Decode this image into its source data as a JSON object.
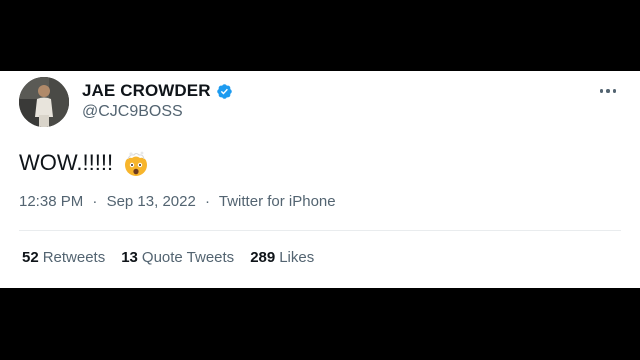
{
  "tweet": {
    "author": {
      "display_name": "JAE CROWDER",
      "handle": "@CJC9BOSS",
      "verified": true
    },
    "text": "WOW.!!!!!",
    "emoji": "exploding-head-icon",
    "time": "12:38 PM",
    "date": "Sep 13, 2022",
    "source": "Twitter for iPhone",
    "separator": "·",
    "stats": {
      "retweets": {
        "count": "52",
        "label": "Retweets"
      },
      "quote_tweets": {
        "count": "13",
        "label": "Quote Tweets"
      },
      "likes": {
        "count": "289",
        "label": "Likes"
      }
    }
  },
  "colors": {
    "background": "#000000",
    "card": "#ffffff",
    "text_primary": "#0f1419",
    "text_secondary": "#536471",
    "verified_blue": "#1d9bf0",
    "divider": "#e9ecee"
  }
}
